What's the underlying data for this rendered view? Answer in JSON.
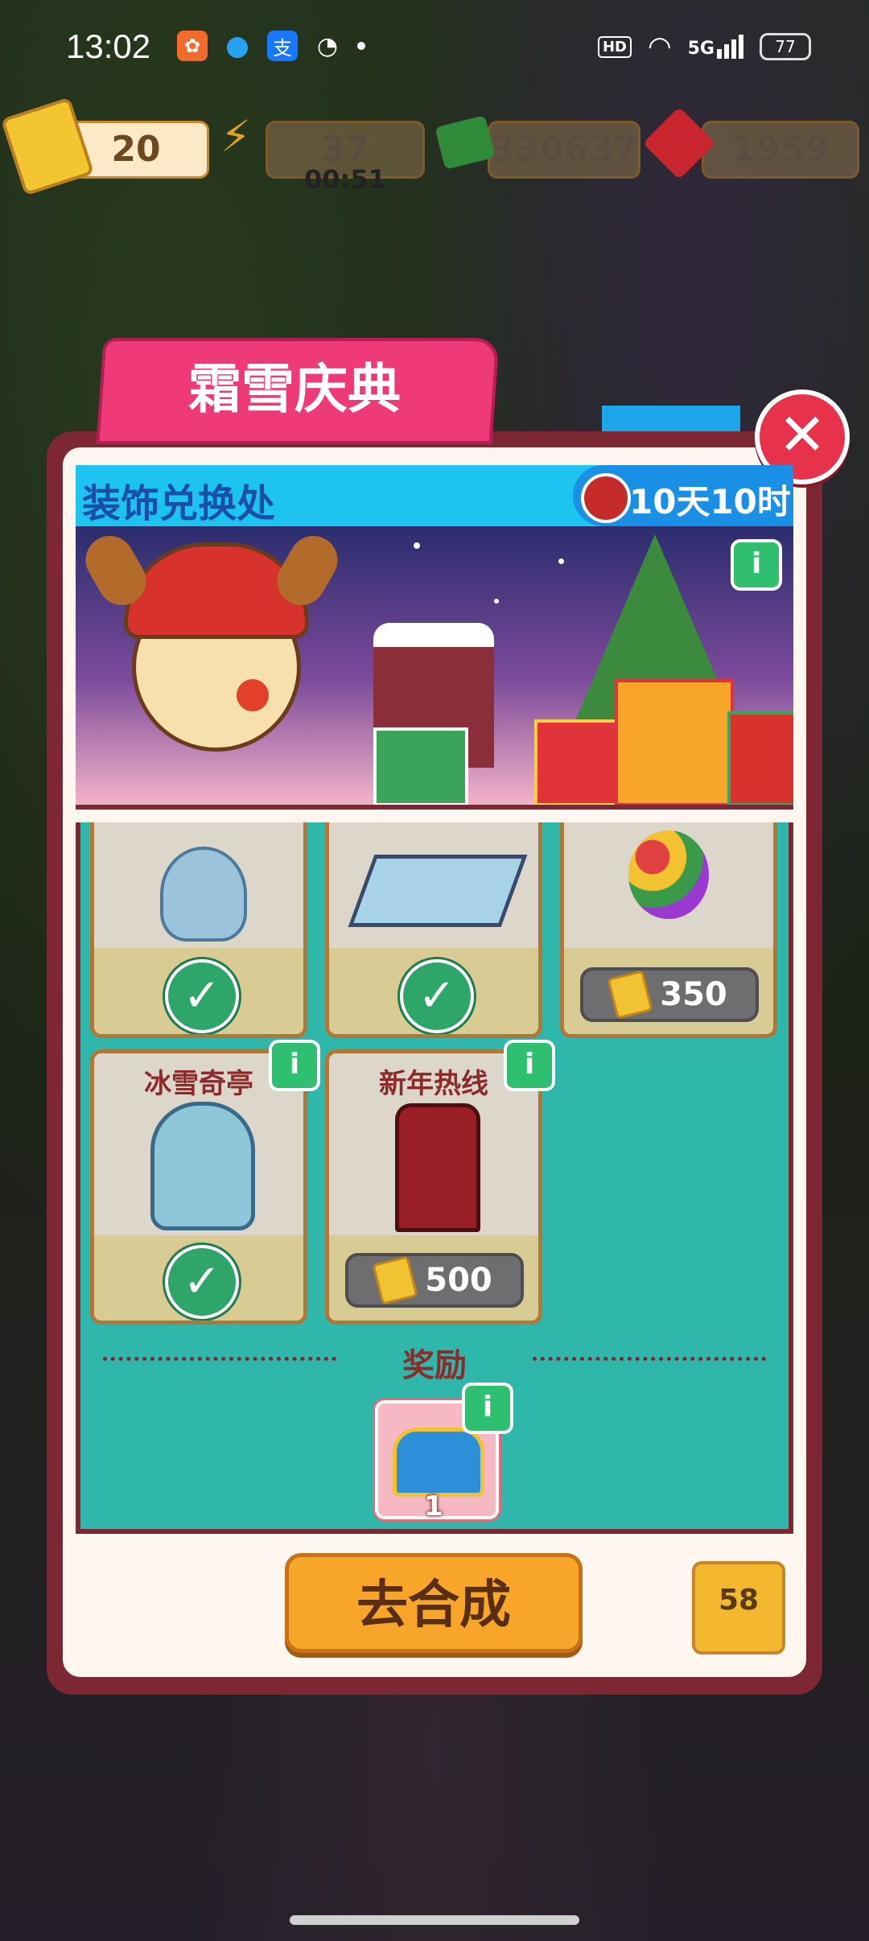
{
  "status_bar": {
    "time": "13:02",
    "hd": "HD",
    "network": "5G",
    "battery": "77"
  },
  "currency": {
    "tickets": "20",
    "energy": "37",
    "energy_timer": "00:51",
    "cash": "330637",
    "gems": "1959"
  },
  "event": {
    "title": "霜雪庆典",
    "section": "装饰兑换处",
    "time_left": "10天10时"
  },
  "items": [
    {
      "name": "",
      "status": "owned",
      "icon": "blue-bear-statue"
    },
    {
      "name": "",
      "status": "owned",
      "icon": "ice-rink"
    },
    {
      "name": "",
      "status": "price",
      "price": "350",
      "icon": "balloon-bunch"
    },
    {
      "name": "冰雪奇亭",
      "status": "owned",
      "icon": "ice-gazebo"
    },
    {
      "name": "新年热线",
      "status": "price",
      "price": "500",
      "icon": "red-phone-booth"
    }
  ],
  "reward": {
    "label": "奖励",
    "count": "1",
    "icon": "treasure-chest"
  },
  "actions": {
    "go_merge": "去合成",
    "trophy_count": "58"
  },
  "colors": {
    "accent_pink": "#ee3a78",
    "panel_teal": "#30b7ab",
    "header_blue": "#1ec4f0",
    "button_orange": "#f7a62a",
    "frame_maroon": "#7d2634"
  }
}
